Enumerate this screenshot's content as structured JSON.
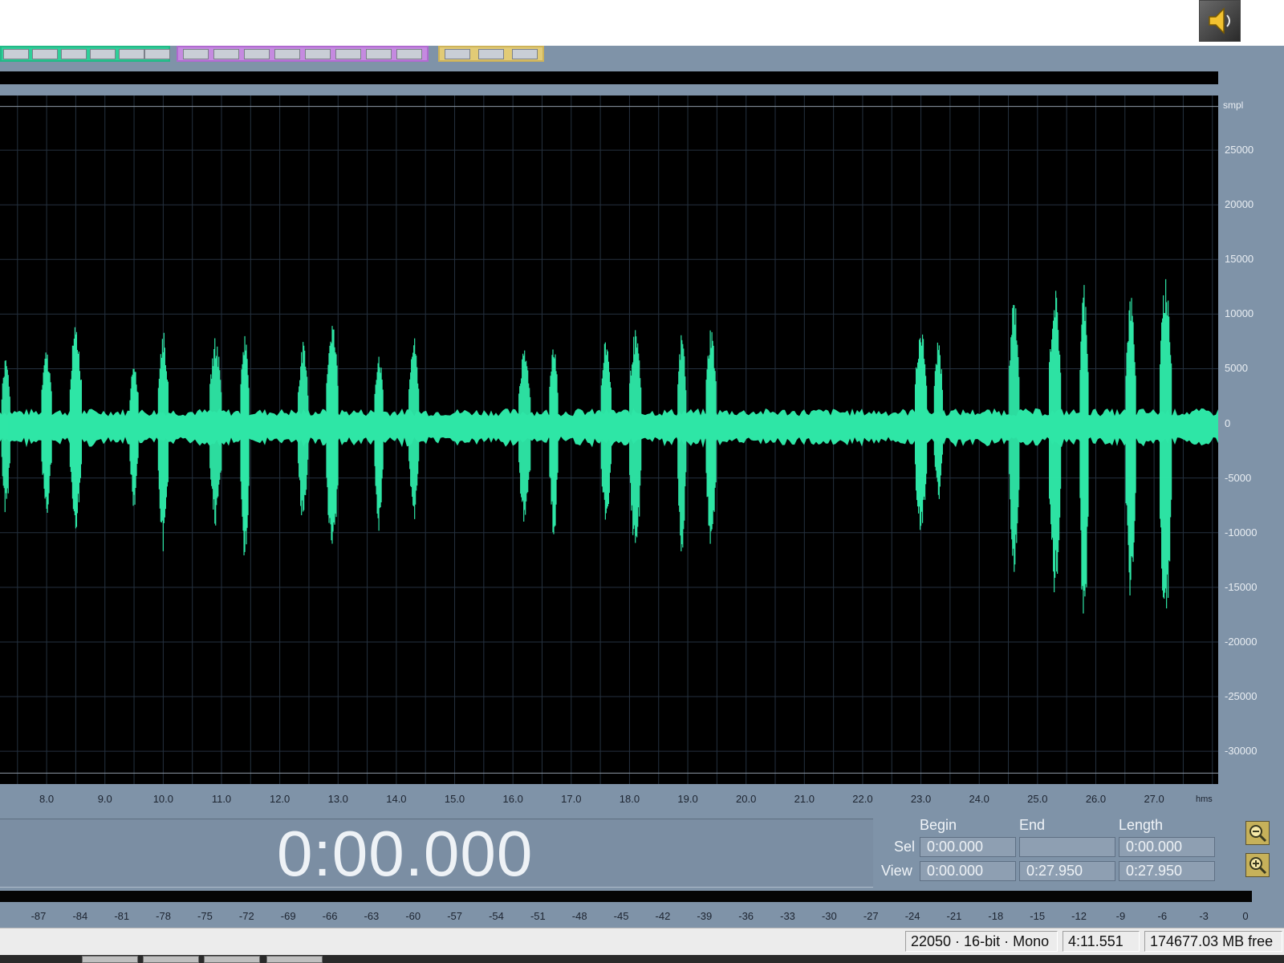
{
  "colors": {
    "waveform": "#2ee6a6",
    "plot_background": "#000000",
    "grid": "#25313f",
    "frame": "#7f93a8"
  },
  "icons": {
    "speaker": "speaker-icon",
    "zoom_in": "zoom-in-icon",
    "zoom_full": "zoom-full-icon"
  },
  "waveform": {
    "y_unit": "smpl",
    "y_ticks": [
      "25000",
      "20000",
      "15000",
      "10000",
      "5000",
      "0",
      "-5000",
      "-10000",
      "-15000",
      "-20000",
      "-25000",
      "-30000"
    ],
    "x_unit": "hms",
    "x_ticks": [
      "8.0",
      "9.0",
      "10.0",
      "11.0",
      "12.0",
      "13.0",
      "14.0",
      "15.0",
      "16.0",
      "17.0",
      "18.0",
      "19.0",
      "20.0",
      "21.0",
      "22.0",
      "23.0",
      "24.0",
      "25.0",
      "26.0",
      "27.0"
    ]
  },
  "chart_data": {
    "type": "area",
    "xlabel": "hms",
    "ylabel": "smpl",
    "xlim": [
      7.2,
      28.1
    ],
    "ylim": [
      -33000,
      30000
    ],
    "grid": true,
    "bursts": [
      {
        "t": 7.3,
        "max": 5500,
        "min": -7500
      },
      {
        "t": 8.0,
        "max": 6000,
        "min": -7500
      },
      {
        "t": 8.5,
        "max": 8000,
        "min": -8500
      },
      {
        "t": 9.5,
        "max": 5500,
        "min": -7000
      },
      {
        "t": 10.0,
        "max": 7500,
        "min": -10500
      },
      {
        "t": 10.9,
        "max": 7000,
        "min": -8500
      },
      {
        "t": 11.4,
        "max": 7500,
        "min": -12000
      },
      {
        "t": 12.4,
        "max": 6500,
        "min": -8500
      },
      {
        "t": 12.9,
        "max": 8500,
        "min": -11000
      },
      {
        "t": 13.7,
        "max": 6000,
        "min": -9000
      },
      {
        "t": 14.3,
        "max": 7000,
        "min": -8000
      },
      {
        "t": 16.2,
        "max": 6000,
        "min": -8500
      },
      {
        "t": 16.7,
        "max": 7000,
        "min": -9500
      },
      {
        "t": 17.6,
        "max": 7000,
        "min": -9000
      },
      {
        "t": 18.1,
        "max": 7500,
        "min": -11000
      },
      {
        "t": 18.9,
        "max": 7500,
        "min": -11000
      },
      {
        "t": 19.4,
        "max": 8000,
        "min": -10500
      },
      {
        "t": 23.0,
        "max": 8000,
        "min": -9500
      },
      {
        "t": 23.3,
        "max": 7000,
        "min": -6500
      },
      {
        "t": 24.6,
        "max": 10500,
        "min": -12000
      },
      {
        "t": 25.3,
        "max": 11000,
        "min": -14000
      },
      {
        "t": 25.8,
        "max": 11500,
        "min": -17500
      },
      {
        "t": 26.6,
        "max": 10500,
        "min": -14500
      },
      {
        "t": 27.2,
        "max": 12000,
        "min": -17500
      }
    ],
    "noise_floor": 1200
  },
  "time_panel": {
    "current_time": "0:00.000",
    "headers": {
      "begin": "Begin",
      "end": "End",
      "length": "Length"
    },
    "rows": {
      "sel": {
        "label": "Sel",
        "begin": "0:00.000",
        "end": "",
        "length": "0:00.000"
      },
      "view": {
        "label": "View",
        "begin": "0:00.000",
        "end": "0:27.950",
        "length": "0:27.950"
      }
    }
  },
  "level_meter": {
    "ticks": [
      "-87",
      "-84",
      "-81",
      "-78",
      "-75",
      "-72",
      "-69",
      "-66",
      "-63",
      "-60",
      "-57",
      "-54",
      "-51",
      "-48",
      "-45",
      "-42",
      "-39",
      "-36",
      "-33",
      "-30",
      "-27",
      "-24",
      "-21",
      "-18",
      "-15",
      "-12",
      "-9",
      "-6",
      "-3",
      "0"
    ]
  },
  "status": {
    "format": "22050 · 16-bit · Mono",
    "duration": "4:11.551",
    "free_space": "174677.03 MB free"
  }
}
